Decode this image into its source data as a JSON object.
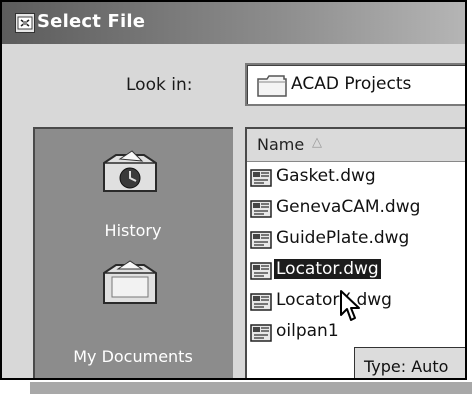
{
  "window": {
    "title": "Select File",
    "title_icon": "select-file-icon"
  },
  "lookin": {
    "label": "Look in:",
    "value": "ACAD Projects",
    "icon": "folder-icon"
  },
  "places": [
    {
      "label": "History",
      "icon": "history-folder-icon"
    },
    {
      "label": "My Documents",
      "icon": "my-documents-folder-icon"
    }
  ],
  "filelist": {
    "column_header": "Name",
    "sort_icon": "sort-ascending-icon",
    "files": [
      {
        "name": "Gasket.dwg",
        "selected": false
      },
      {
        "name": "GenevaCAM.dwg",
        "selected": false
      },
      {
        "name": "GuidePlate.dwg",
        "selected": false
      },
      {
        "name": "Locator.dwg",
        "selected": true
      },
      {
        "name": "LocatorX.dwg",
        "selected": false
      },
      {
        "name": "oilpan1",
        "selected": false
      }
    ]
  },
  "tooltip": {
    "text": "Type: Auto"
  }
}
